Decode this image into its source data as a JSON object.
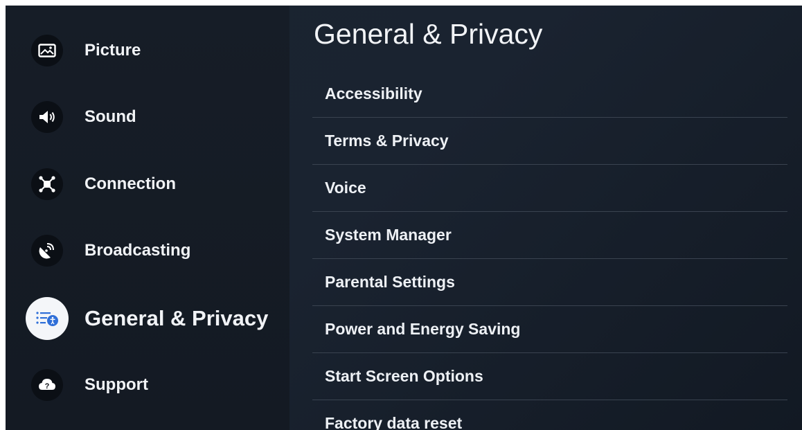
{
  "sidebar": {
    "items": [
      {
        "label": "Picture",
        "icon": "picture-icon",
        "active": false
      },
      {
        "label": "Sound",
        "icon": "sound-icon",
        "active": false
      },
      {
        "label": "Connection",
        "icon": "connection-icon",
        "active": false
      },
      {
        "label": "Broadcasting",
        "icon": "broadcasting-icon",
        "active": false
      },
      {
        "label": "General & Privacy",
        "icon": "general-privacy-icon",
        "active": true
      },
      {
        "label": "Support",
        "icon": "support-icon",
        "active": false
      }
    ]
  },
  "main": {
    "title": "General & Privacy",
    "items": [
      "Accessibility",
      "Terms & Privacy",
      "Voice",
      "System Manager",
      "Parental Settings",
      "Power and Energy Saving",
      "Start Screen Options",
      "Factory data reset"
    ]
  },
  "colors": {
    "background": "#1a2330",
    "sidebar": "#161d27",
    "active_icon_bg": "#f4f6f9",
    "accent": "#2f6fd8",
    "text": "#f1f3f6",
    "divider": "#3a4350"
  }
}
